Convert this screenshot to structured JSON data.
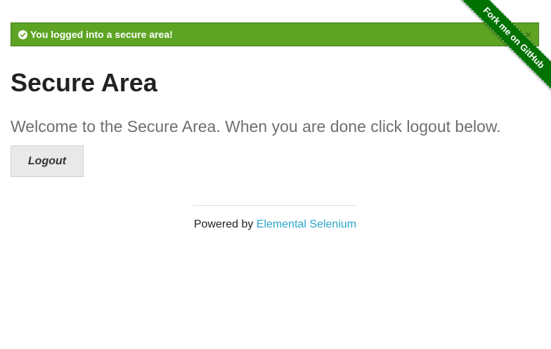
{
  "flash": {
    "message": "You logged into a secure area!",
    "close_label": "×",
    "color": "#5da423"
  },
  "main": {
    "title": "Secure Area",
    "subheader": "Welcome to the Secure Area. When you are done click logout below.",
    "logout_label": "Logout"
  },
  "footer": {
    "prefix": "Powered by ",
    "link_text": "Elemental Selenium",
    "link_color": "#2ba6cb"
  },
  "ribbon": {
    "text": "Fork me on GitHub",
    "color": "#007200"
  },
  "icons": {
    "flash_icon": "check-circle-icon"
  }
}
